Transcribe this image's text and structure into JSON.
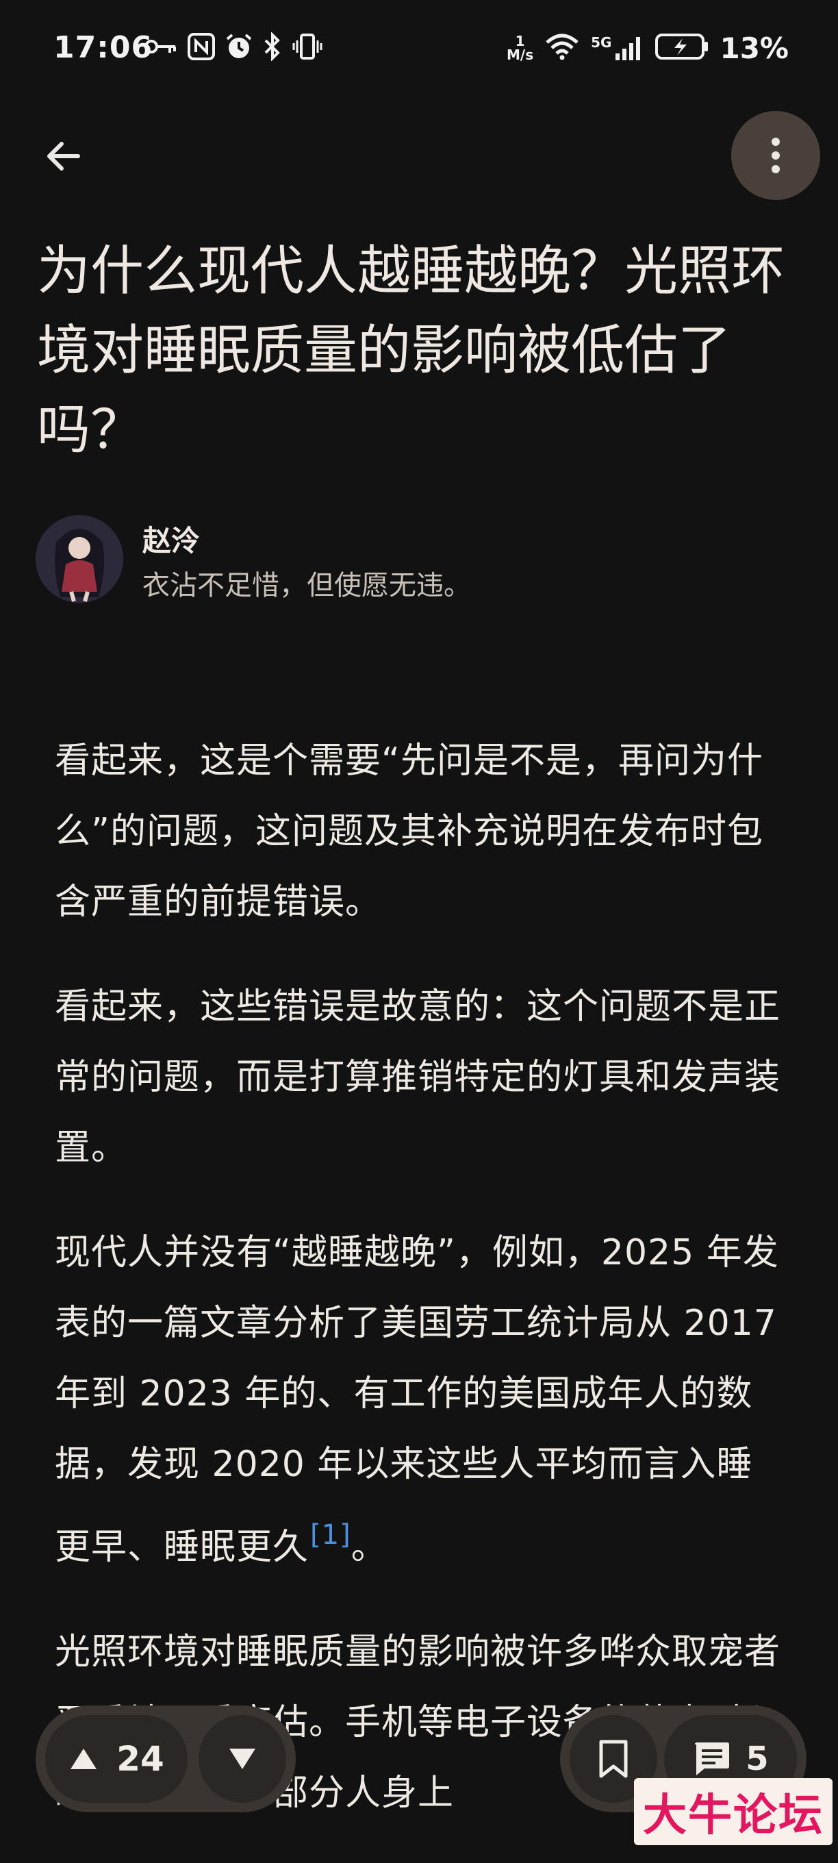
{
  "status_bar": {
    "time": "17:06",
    "net_speed_value": "1",
    "net_speed_unit": "M/s",
    "signal_label": "5G",
    "battery_percent": "13%"
  },
  "header": {
    "back_icon": "arrow-left-icon",
    "more_icon": "more-vertical-icon"
  },
  "question": {
    "title": "为什么现代人越睡越晚？光照环境对睡眠质量的影响被低估了吗？"
  },
  "author": {
    "name": "赵泠",
    "bio": "衣沾不足惜，但使愿无违。"
  },
  "answer": {
    "paragraphs": [
      "看起来，这是个需要“先问是不是，再问为什么”的问题，这问题及其补充说明在发布时包含严重的前提错误。",
      "看起来，这些错误是故意的：这个问题不是正常的问题，而是打算推销特定的灯具和发声装置。",
      "现代人并没有“越睡越晚”，例如，2025 年发表的一篇文章分析了美国劳工统计局从 2017 年到 2023 年的、有工作的美国成年人的数据，发现 2020 年以来这些人平均而言入睡更早、睡眠更久",
      "光照环境对睡眠质量的影响被许多哗众取宠者严重地严重高估。手机等电子设备的蓝光对入睡的影响在一部分人身上"
    ],
    "ref_marker": "[1]",
    "para3_end": "。"
  },
  "bottom_bar": {
    "upvote_count": "24",
    "comment_count": "5"
  },
  "watermark": {
    "text": "大牛论坛"
  },
  "colors": {
    "background": "#121212",
    "link": "#4d8fe0",
    "pill": "#3a3530",
    "watermark": "#e4165f"
  }
}
